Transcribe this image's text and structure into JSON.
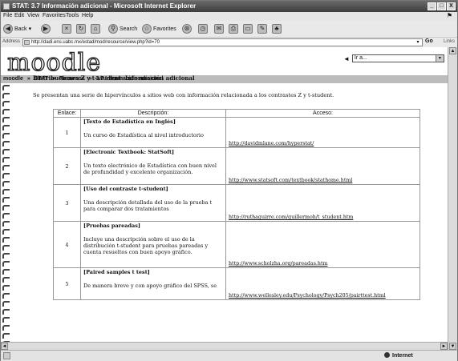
{
  "window": {
    "title": "STAT: 3.7 Información adicional - Microsoft Internet Explorer",
    "buttons": {
      "minimize": "_",
      "maximize": "□",
      "close": "X"
    }
  },
  "menubar": {
    "items": [
      "File",
      "Edit",
      "View",
      "Favorites",
      "Tools",
      "Help"
    ]
  },
  "toolbar": {
    "back": "Back",
    "search": "Search",
    "favorites": "Favorites"
  },
  "addressbar": {
    "label": "Address",
    "url": "http://dadi.ens.uabc.mx/estad/mod/resource/view.php?id=70",
    "go": "Go",
    "links": "Links"
  },
  "page": {
    "logo": "moodle",
    "jump": {
      "arrow": "◄",
      "selected": "Ir a..."
    },
    "breadcrumb": [
      "moodle",
      "STAT",
      "Recursos",
      "3.7 Información adicional"
    ],
    "breadcrumb_sep": "»",
    "heading": "Distribuciones Z y t-student: Información adicional",
    "intro": "Se presentan una serie de hipervínculos a sitios web con información relacionada a los contrastes Z y t-student.",
    "table": {
      "headers": [
        "Enlace:",
        "Descripción:",
        "Acceso:"
      ],
      "rows": [
        {
          "num": "1",
          "title": "[Texto de Estadística en Inglés]",
          "desc": "Un curso de Estadística al nivel introductorio",
          "url": "http://davidmlane.com/hyperstat/"
        },
        {
          "num": "2",
          "title": "[Electronic Textbook: StatSoft]",
          "desc": "Un texto electrónico de Estadística con buen nivel de profundidad y excelente organización.",
          "url": "http://www.statsoft.com/textbook/stathome.html"
        },
        {
          "num": "3",
          "title": "[Uso del contraste t-student]",
          "desc": "Una descripción detallada del uso de la prueba t para comparar dos tratamientos",
          "url": "http://ruthaguirre.com/guillermoh/t_student.htm"
        },
        {
          "num": "4",
          "title": "[Pruebas pareadas]",
          "desc": "Incluye una descripción sobre el uso de la distribución t-student para pruebas pareadas y cuenta resueltos con buen apoyo gráfico.",
          "url": "http://www.scholzha.org/pareadas.htm"
        },
        {
          "num": "5",
          "title": "[Paired samples t test]",
          "desc": "De manera breve y con apoyo gráfico del SPSS, se",
          "url": "http://www.wellesley.edu/Psychology/Psych205/pairttest.html"
        }
      ]
    }
  },
  "statusbar": {
    "zone": "Internet"
  }
}
